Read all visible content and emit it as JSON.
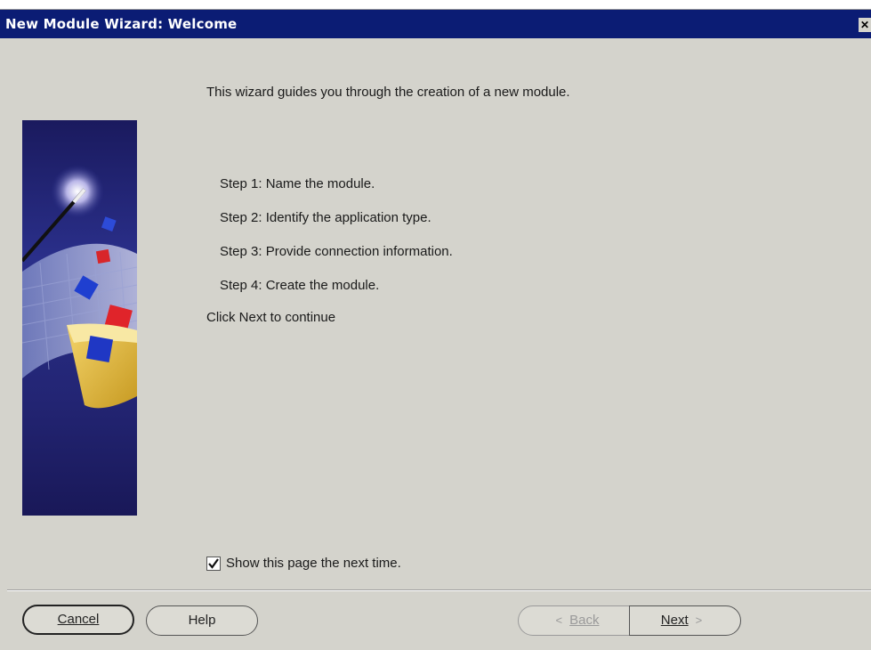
{
  "window": {
    "title": "New Module Wizard: Welcome",
    "close_glyph": "✕"
  },
  "content": {
    "intro": "This wizard guides you through the creation of a new module.",
    "steps": [
      "Step 1: Name the module.",
      "Step 2: Identify the application type.",
      "Step 3: Provide connection information.",
      "Step 4: Create the module."
    ],
    "click_next": "Click Next to continue",
    "show_page_label": "Show this page the next time.",
    "show_page_checked": true
  },
  "buttons": {
    "cancel": "Cancel",
    "help": "Help",
    "back": "Back",
    "next": "Next",
    "back_arrow": "<",
    "next_arrow": ">"
  },
  "icons": {
    "side_art": "wizard-wand-folder-illustration",
    "check": "check-icon",
    "close": "close-icon"
  },
  "colors": {
    "titlebar": "#0b1c74",
    "dialog_bg": "#d4d3cc",
    "side_panel": "#1b1a6a"
  }
}
